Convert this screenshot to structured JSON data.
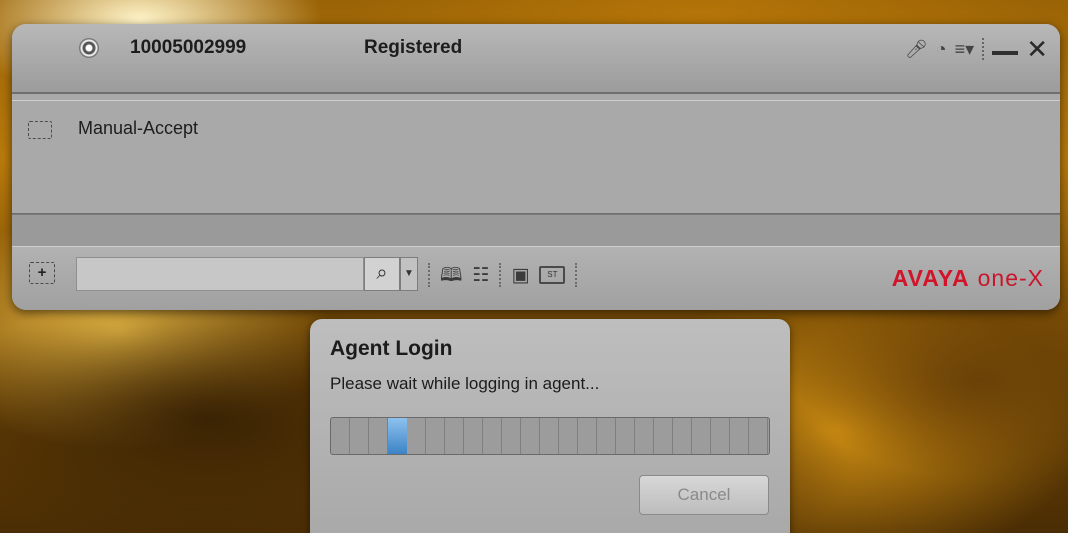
{
  "titlebar": {
    "extension": "10005002999",
    "status": "Registered",
    "icons": [
      "mute-mic-icon",
      "headset-icon",
      "menu-icon",
      "minimize-icon",
      "close-icon"
    ]
  },
  "work_area": {
    "items": [
      {
        "label": "Manual-Accept",
        "icon": "checkbox-icon"
      }
    ]
  },
  "toolbar": {
    "add_icon": "plus-icon",
    "dial_value": "",
    "search_icon": "search-icon",
    "tools": [
      "contacts-book-icon",
      "dialpad-icon",
      "window-icon",
      "status-box-icon"
    ],
    "brand_primary": "AVAYA",
    "brand_secondary": "one-X",
    "brand_color": "#d1142a"
  },
  "dialog": {
    "title": "Agent Login",
    "message": "Please wait while logging in agent...",
    "progress_segments": 23,
    "progress_active_segment": 3,
    "cancel_label": "Cancel"
  }
}
